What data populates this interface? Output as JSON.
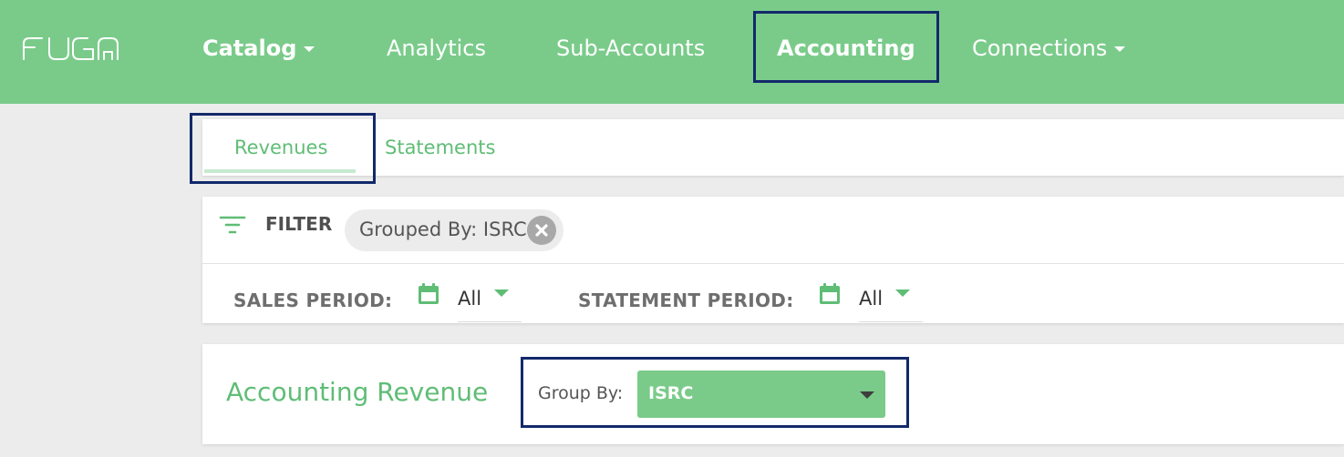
{
  "nav": {
    "logo_text": "FUGA",
    "items": [
      {
        "label": "Catalog",
        "has_dropdown": true
      },
      {
        "label": "Analytics",
        "has_dropdown": false
      },
      {
        "label": "Sub-Accounts",
        "has_dropdown": false
      },
      {
        "label": "Accounting",
        "has_dropdown": false,
        "active": true
      },
      {
        "label": "Connections",
        "has_dropdown": true
      }
    ]
  },
  "tabs": [
    {
      "label": "Revenues",
      "active": true
    },
    {
      "label": "Statements",
      "active": false
    }
  ],
  "filter": {
    "label": "FILTER",
    "icon": "filter-icon",
    "chips": [
      {
        "label": "Grouped By: ISRC",
        "removable": true
      }
    ],
    "sales_period": {
      "label": "SALES PERIOD:",
      "value": "All",
      "icon": "calendar-icon"
    },
    "statement_period": {
      "label": "STATEMENT PERIOD:",
      "value": "All",
      "icon": "calendar-icon"
    }
  },
  "revenue": {
    "title": "Accounting Revenue",
    "group_by_label": "Group By:",
    "group_by_value": "ISRC"
  },
  "colors": {
    "brand_green": "#7acb8a",
    "text_green": "#5fbd76",
    "highlight_border": "#13296b",
    "background": "#ececec"
  }
}
